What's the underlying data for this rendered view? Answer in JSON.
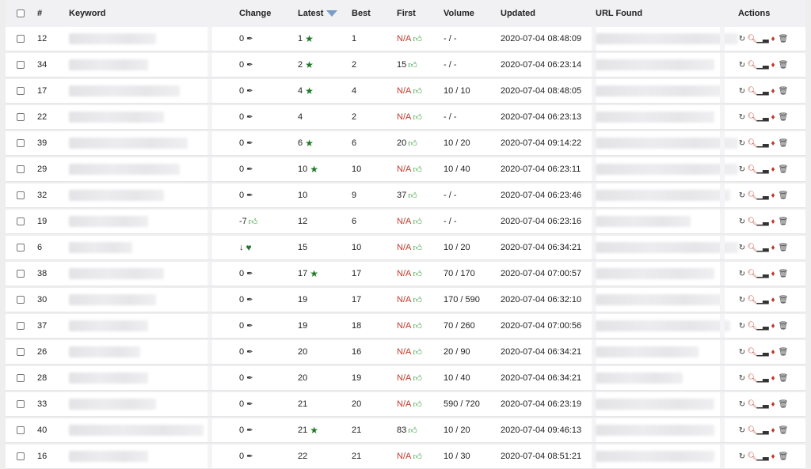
{
  "headers": {
    "num": "#",
    "keyword": "Keyword",
    "change": "Change",
    "latest": "Latest",
    "best": "Best",
    "first": "First",
    "volume": "Volume",
    "updated": "Updated",
    "url_found": "URL Found",
    "actions": "Actions"
  },
  "rows": [
    {
      "num": "12",
      "change": "0",
      "change_icon": "pin",
      "latest": "1",
      "latest_star": true,
      "best": "1",
      "first": "N/A",
      "first_na": true,
      "volume": "- / -",
      "updated": "2020-07-04 08:48:09"
    },
    {
      "num": "34",
      "change": "0",
      "change_icon": "pin",
      "latest": "2",
      "latest_star": true,
      "best": "2",
      "first": "15",
      "first_na": false,
      "volume": "- / -",
      "updated": "2020-07-04 06:23:14"
    },
    {
      "num": "17",
      "change": "0",
      "change_icon": "pin",
      "latest": "4",
      "latest_star": true,
      "best": "4",
      "first": "N/A",
      "first_na": true,
      "volume": "10 / 10",
      "updated": "2020-07-04 08:48:05"
    },
    {
      "num": "22",
      "change": "0",
      "change_icon": "pin",
      "latest": "4",
      "latest_star": false,
      "best": "2",
      "first": "N/A",
      "first_na": true,
      "volume": "- / -",
      "updated": "2020-07-04 06:23:13"
    },
    {
      "num": "39",
      "change": "0",
      "change_icon": "pin",
      "latest": "6",
      "latest_star": true,
      "best": "6",
      "first": "20",
      "first_na": false,
      "volume": "10 / 20",
      "updated": "2020-07-04 09:14:22"
    },
    {
      "num": "29",
      "change": "0",
      "change_icon": "pin",
      "latest": "10",
      "latest_star": true,
      "best": "10",
      "first": "N/A",
      "first_na": true,
      "volume": "10 / 40",
      "updated": "2020-07-04 06:23:11"
    },
    {
      "num": "32",
      "change": "0",
      "change_icon": "pin",
      "latest": "10",
      "latest_star": false,
      "best": "9",
      "first": "37",
      "first_na": false,
      "volume": "- / -",
      "updated": "2020-07-04 06:23:46"
    },
    {
      "num": "19",
      "change": "-7",
      "change_icon": "thumb",
      "latest": "12",
      "latest_star": false,
      "best": "6",
      "first": "N/A",
      "first_na": true,
      "volume": "- / -",
      "updated": "2020-07-04 06:23:16"
    },
    {
      "num": "6",
      "change": "↓",
      "change_icon": "heart",
      "latest": "15",
      "latest_star": false,
      "best": "10",
      "first": "N/A",
      "first_na": true,
      "volume": "10 / 20",
      "updated": "2020-07-04 06:34:21"
    },
    {
      "num": "38",
      "change": "0",
      "change_icon": "pin",
      "latest": "17",
      "latest_star": true,
      "best": "17",
      "first": "N/A",
      "first_na": true,
      "volume": "70 / 170",
      "updated": "2020-07-04 07:00:57"
    },
    {
      "num": "30",
      "change": "0",
      "change_icon": "pin",
      "latest": "19",
      "latest_star": false,
      "best": "17",
      "first": "N/A",
      "first_na": true,
      "volume": "170 / 590",
      "updated": "2020-07-04 06:32:10"
    },
    {
      "num": "37",
      "change": "0",
      "change_icon": "pin",
      "latest": "19",
      "latest_star": false,
      "best": "18",
      "first": "N/A",
      "first_na": true,
      "volume": "70 / 260",
      "updated": "2020-07-04 07:00:56"
    },
    {
      "num": "26",
      "change": "0",
      "change_icon": "pin",
      "latest": "20",
      "latest_star": false,
      "best": "16",
      "first": "N/A",
      "first_na": true,
      "volume": "20 / 90",
      "updated": "2020-07-04 06:34:21"
    },
    {
      "num": "28",
      "change": "0",
      "change_icon": "pin",
      "latest": "20",
      "latest_star": false,
      "best": "19",
      "first": "N/A",
      "first_na": true,
      "volume": "10 / 40",
      "updated": "2020-07-04 06:34:21"
    },
    {
      "num": "33",
      "change": "0",
      "change_icon": "pin",
      "latest": "21",
      "latest_star": false,
      "best": "20",
      "first": "N/A",
      "first_na": true,
      "volume": "590 / 720",
      "updated": "2020-07-04 06:23:19"
    },
    {
      "num": "40",
      "change": "0",
      "change_icon": "pin",
      "latest": "21",
      "latest_star": true,
      "best": "21",
      "first": "83",
      "first_na": false,
      "volume": "10 / 20",
      "updated": "2020-07-04 09:46:13"
    },
    {
      "num": "16",
      "change": "0",
      "change_icon": "pin",
      "latest": "22",
      "latest_star": false,
      "best": "21",
      "first": "N/A",
      "first_na": true,
      "volume": "10 / 30",
      "updated": "2020-07-04 08:51:21"
    }
  ],
  "icons": {
    "pin": "📌-like pin-icon",
    "star": "star-icon",
    "thumb": "thumbs-up-icon",
    "heart": "heart-icon",
    "sort": "sort-down-icon",
    "actions": [
      "refresh-icon",
      "search-icon",
      "chart-icon",
      "tag-icon",
      "trash-icon"
    ]
  },
  "colors": {
    "na_red": "#c0392b",
    "green": "#2e9a32",
    "sort_blue": "#7a9cc6"
  }
}
